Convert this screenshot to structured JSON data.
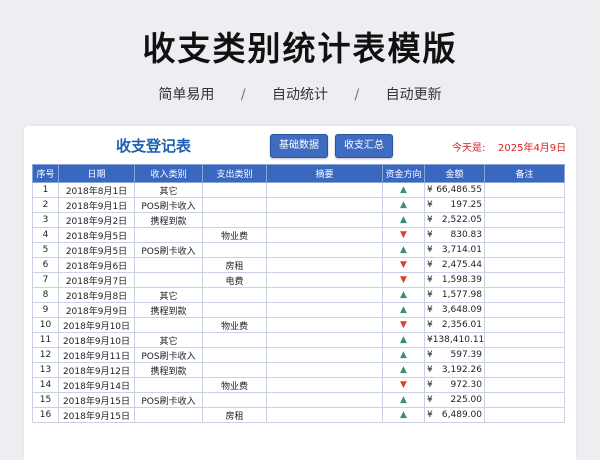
{
  "header": {
    "title": "收支类别统计表模版",
    "tags": [
      "简单易用",
      "自动统计",
      "自动更新"
    ],
    "separator": "/"
  },
  "sheet": {
    "title": "收支登记表",
    "buttons": [
      "基础数据",
      "收支汇总"
    ],
    "today_label": "今天是:",
    "today_value": "2025年4月9日"
  },
  "table": {
    "headers": [
      "序号",
      "日期",
      "收入类别",
      "支出类别",
      "摘要",
      "资金方向",
      "金额",
      "备注"
    ],
    "currency": "¥",
    "colors": {
      "header_bg": "#3a67bf",
      "up": "#3c8f72",
      "down": "#d9432a"
    },
    "rows": [
      {
        "no": "1",
        "date": "2018年8月1日",
        "income": "其它",
        "expense": "",
        "summary": "",
        "dir": "up",
        "amount": "66,486.55",
        "note": ""
      },
      {
        "no": "2",
        "date": "2018年9月1日",
        "income": "POS刷卡收入",
        "expense": "",
        "summary": "",
        "dir": "up",
        "amount": "197.25",
        "note": ""
      },
      {
        "no": "3",
        "date": "2018年9月2日",
        "income": "携程到款",
        "expense": "",
        "summary": "",
        "dir": "up",
        "amount": "2,522.05",
        "note": ""
      },
      {
        "no": "4",
        "date": "2018年9月5日",
        "income": "",
        "expense": "物业费",
        "summary": "",
        "dir": "down",
        "amount": "830.83",
        "note": ""
      },
      {
        "no": "5",
        "date": "2018年9月5日",
        "income": "POS刷卡收入",
        "expense": "",
        "summary": "",
        "dir": "up",
        "amount": "3,714.01",
        "note": ""
      },
      {
        "no": "6",
        "date": "2018年9月6日",
        "income": "",
        "expense": "房租",
        "summary": "",
        "dir": "down",
        "amount": "2,475.44",
        "note": ""
      },
      {
        "no": "7",
        "date": "2018年9月7日",
        "income": "",
        "expense": "电费",
        "summary": "",
        "dir": "down",
        "amount": "1,598.39",
        "note": ""
      },
      {
        "no": "8",
        "date": "2018年9月8日",
        "income": "其它",
        "expense": "",
        "summary": "",
        "dir": "up",
        "amount": "1,577.98",
        "note": ""
      },
      {
        "no": "9",
        "date": "2018年9月9日",
        "income": "携程到款",
        "expense": "",
        "summary": "",
        "dir": "up",
        "amount": "3,648.09",
        "note": ""
      },
      {
        "no": "10",
        "date": "2018年9月10日",
        "income": "",
        "expense": "物业费",
        "summary": "",
        "dir": "down",
        "amount": "2,356.01",
        "note": ""
      },
      {
        "no": "11",
        "date": "2018年9月10日",
        "income": "其它",
        "expense": "",
        "summary": "",
        "dir": "up",
        "amount": "138,410.11",
        "note": ""
      },
      {
        "no": "12",
        "date": "2018年9月11日",
        "income": "POS刷卡收入",
        "expense": "",
        "summary": "",
        "dir": "up",
        "amount": "597.39",
        "note": ""
      },
      {
        "no": "13",
        "date": "2018年9月12日",
        "income": "携程到款",
        "expense": "",
        "summary": "",
        "dir": "up",
        "amount": "3,192.26",
        "note": ""
      },
      {
        "no": "14",
        "date": "2018年9月14日",
        "income": "",
        "expense": "物业费",
        "summary": "",
        "dir": "down",
        "amount": "972.30",
        "note": ""
      },
      {
        "no": "15",
        "date": "2018年9月15日",
        "income": "POS刷卡收入",
        "expense": "",
        "summary": "",
        "dir": "up",
        "amount": "225.00",
        "note": ""
      },
      {
        "no": "16",
        "date": "2018年9月15日",
        "income": "",
        "expense": "房租",
        "summary": "",
        "dir": "up",
        "amount": "6,489.00",
        "note": ""
      }
    ]
  }
}
